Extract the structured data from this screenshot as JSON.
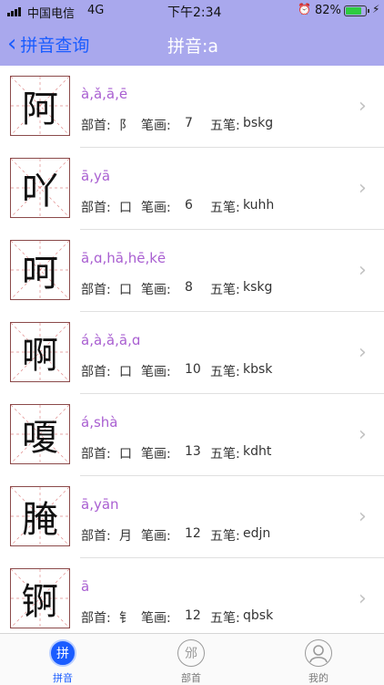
{
  "status": {
    "carrier": "中国电信",
    "network": "4G",
    "time": "下午2:34",
    "battery": "82%",
    "battery_level": 0.82
  },
  "nav": {
    "back_label": "拼音查询",
    "title": "拼音:a"
  },
  "labels": {
    "radical": "部首:",
    "strokes": "笔画:",
    "wubi": "五笔:"
  },
  "items": [
    {
      "char": "阿",
      "pinyin": "à,ǎ,ā,ē",
      "radical": "阝",
      "strokes": "7",
      "wubi": "bskg"
    },
    {
      "char": "吖",
      "pinyin": "ā,yā",
      "radical": "口",
      "strokes": "6",
      "wubi": "kuhh"
    },
    {
      "char": "呵",
      "pinyin": "ā,ɑ,hā,hē,kē",
      "radical": "口",
      "strokes": "8",
      "wubi": "kskg"
    },
    {
      "char": "啊",
      "pinyin": "á,à,ǎ,ā,ɑ",
      "radical": "口",
      "strokes": "10",
      "wubi": "kbsk"
    },
    {
      "char": "嗄",
      "pinyin": "á,shà",
      "radical": "口",
      "strokes": "13",
      "wubi": "kdht"
    },
    {
      "char": "腌",
      "pinyin": "ā,yān",
      "radical": "月",
      "strokes": "12",
      "wubi": "edjn"
    },
    {
      "char": "锕",
      "pinyin": "ā",
      "radical": "钅",
      "strokes": "12",
      "wubi": "qbsk"
    }
  ],
  "tabs": [
    {
      "label": "拼音",
      "icon": "拼",
      "active": true
    },
    {
      "label": "部首",
      "icon": "邠",
      "active": false
    },
    {
      "label": "我的",
      "icon": "person",
      "active": false
    }
  ],
  "colors": {
    "header": "#a9a8ed",
    "accent": "#1a5cff",
    "pinyin": "#a95fd1",
    "grid_border": "#8b4a4a",
    "grid_guides": "#e08a8a"
  }
}
